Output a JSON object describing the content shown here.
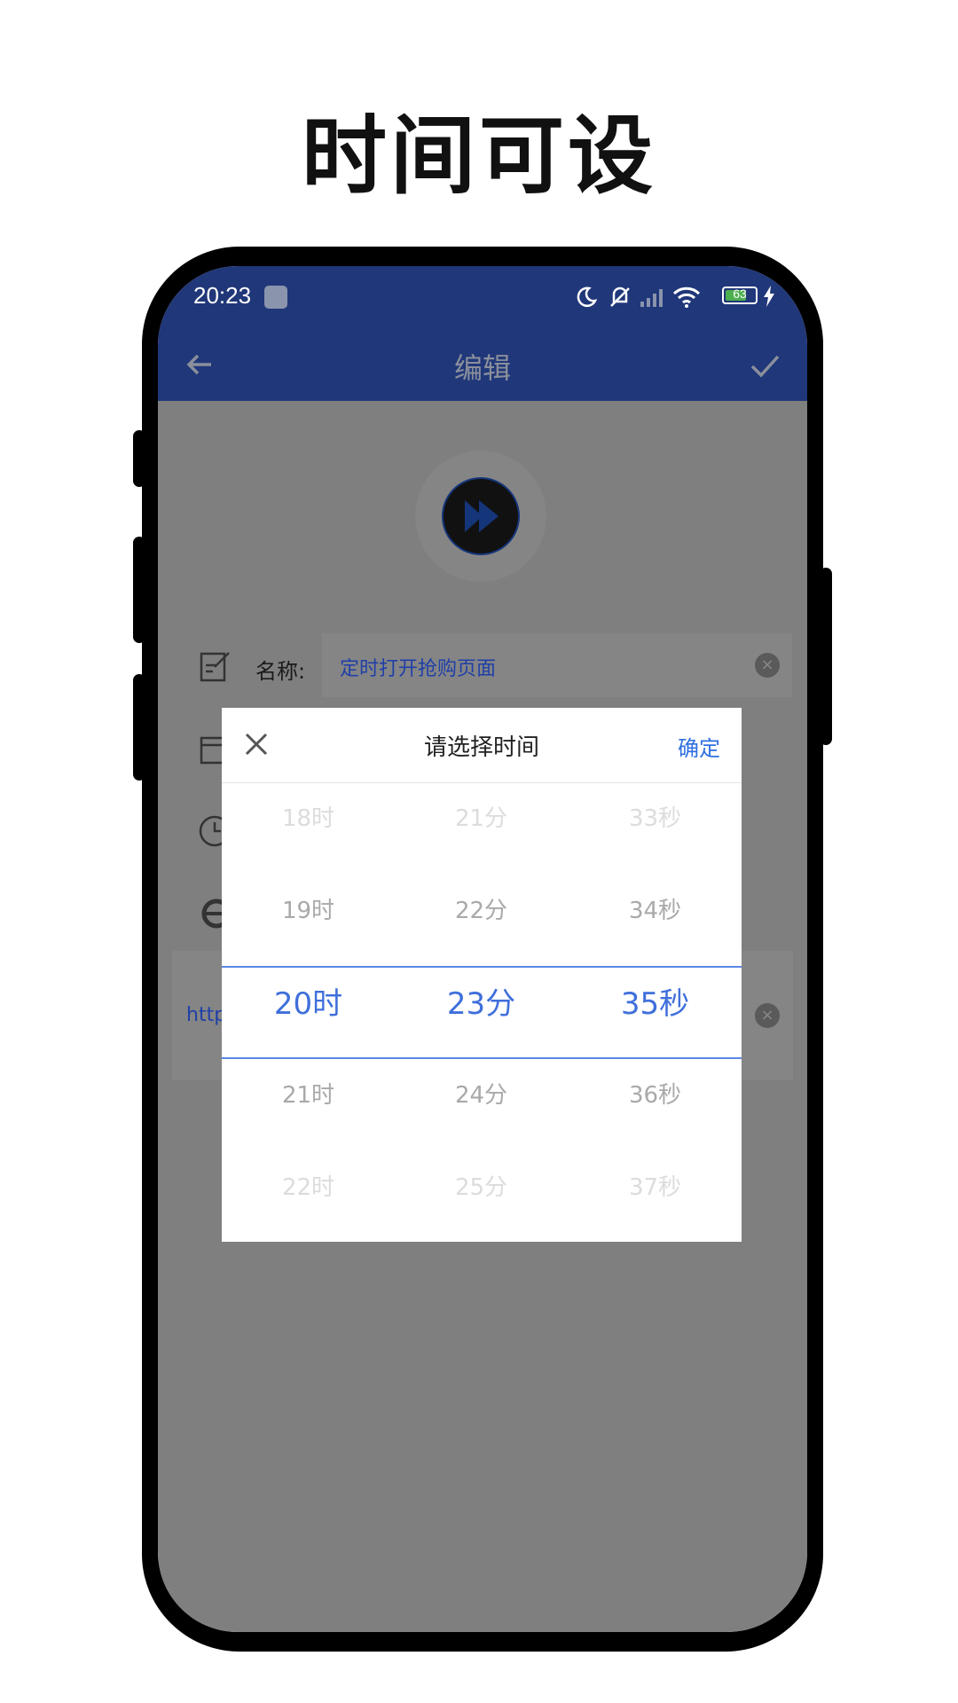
{
  "headline": "时间可设",
  "status_bar": {
    "time": "20:23",
    "battery": "63"
  },
  "app_bar": {
    "title": "编辑"
  },
  "form": {
    "name_label": "名称:",
    "name_value": "定时打开抢购页面",
    "url_value": "http"
  },
  "time_picker": {
    "title": "请选择时间",
    "cancel_icon": "close-icon",
    "confirm_label": "确定",
    "hours": [
      "18时",
      "19时",
      "20时",
      "21时",
      "22时"
    ],
    "minutes": [
      "21分",
      "22分",
      "23分",
      "24分",
      "25分"
    ],
    "seconds": [
      "33秒",
      "34秒",
      "35秒",
      "36秒",
      "37秒"
    ],
    "selected": {
      "hour": "20时",
      "minute": "23分",
      "second": "35秒"
    }
  },
  "colors": {
    "app_bar": "#203779",
    "accent": "#3f6fdb",
    "overlay": "#7f7f7f"
  }
}
